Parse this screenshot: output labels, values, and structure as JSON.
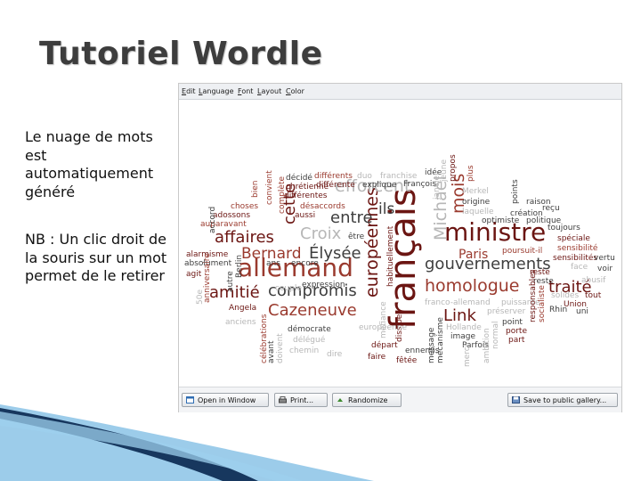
{
  "slide": {
    "title": "Tutoriel Wordle",
    "paragraph1": "Le nuage de mots est automatiquement généré",
    "paragraph2": "NB : Un clic droit de la souris sur un mot permet de le retirer"
  },
  "menu": [
    "Edit",
    "Language",
    "Font",
    "Layout",
    "Color"
  ],
  "buttons": {
    "open_window": "Open in Window",
    "print": "Print...",
    "randomize": "Randomize",
    "save_gallery": "Save to public gallery..."
  },
  "colors": {
    "dark_red": "#6b1512",
    "mid_red": "#9a3a2e",
    "dark_gray": "#3e3e3e",
    "light_gray": "#b7b7b7",
    "accent_blue": "#4aa3d8",
    "accent_navy": "#17375e"
  },
  "cloud_words": {
    "big": [
      "français",
      "ministre",
      "allemand",
      "européennes",
      "Michael",
      "mois",
      "efforcent",
      "gouvernements",
      "homologue",
      "traité",
      "compromis",
      "Cazeneuve",
      "Croix",
      "Élysée",
      "affaires",
      "Bernard",
      "amitié",
      "entre",
      "cette",
      "Link",
      "Paris",
      "ils"
    ],
    "small": [
      "décidé",
      "différents",
      "duo",
      "franchise",
      "idée",
      "jeune",
      "propos",
      "plus",
      "chrétienne",
      "différente",
      "explique",
      "François",
      "différentes",
      "Merkel",
      "origine",
      "points",
      "raison",
      "reçu",
      "choses",
      "désaccords",
      "laquelle",
      "création",
      "adossons",
      "aussi",
      "optimiste",
      "politique",
      "toujours",
      "auparavant",
      "être",
      "spéciale",
      "sensibilité",
      "sensibilités",
      "vertu",
      "voir",
      "alarmisme",
      "ans",
      "encore",
      "poursuit-il",
      "face",
      "absolument",
      "Berlin",
      "agit",
      "reste",
      "solides",
      "tout",
      "autre",
      "couple",
      "expression",
      "Union",
      "Angela",
      "uni",
      "Rhin",
      "franco-allemand",
      "puissante",
      "préserver",
      "anciens",
      "démocrate",
      "porte",
      "part",
      "point",
      "image",
      "Parfois",
      "normal",
      "délégué",
      "départ",
      "chemin",
      "dire",
      "faire",
      "fêtée",
      "ennemis",
      "message",
      "mécanisme",
      "Hollande",
      "ambition",
      "dissiper",
      "habituellement",
      "célébrations",
      "avant",
      "doivent",
      "responsables",
      "socialiste",
      "janvier",
      "anniversaire",
      "accord",
      "convient",
      "complète",
      "bien",
      "abusif",
      "merci",
      "méfiance",
      "reste",
      "50e",
      "européenne"
    ]
  }
}
